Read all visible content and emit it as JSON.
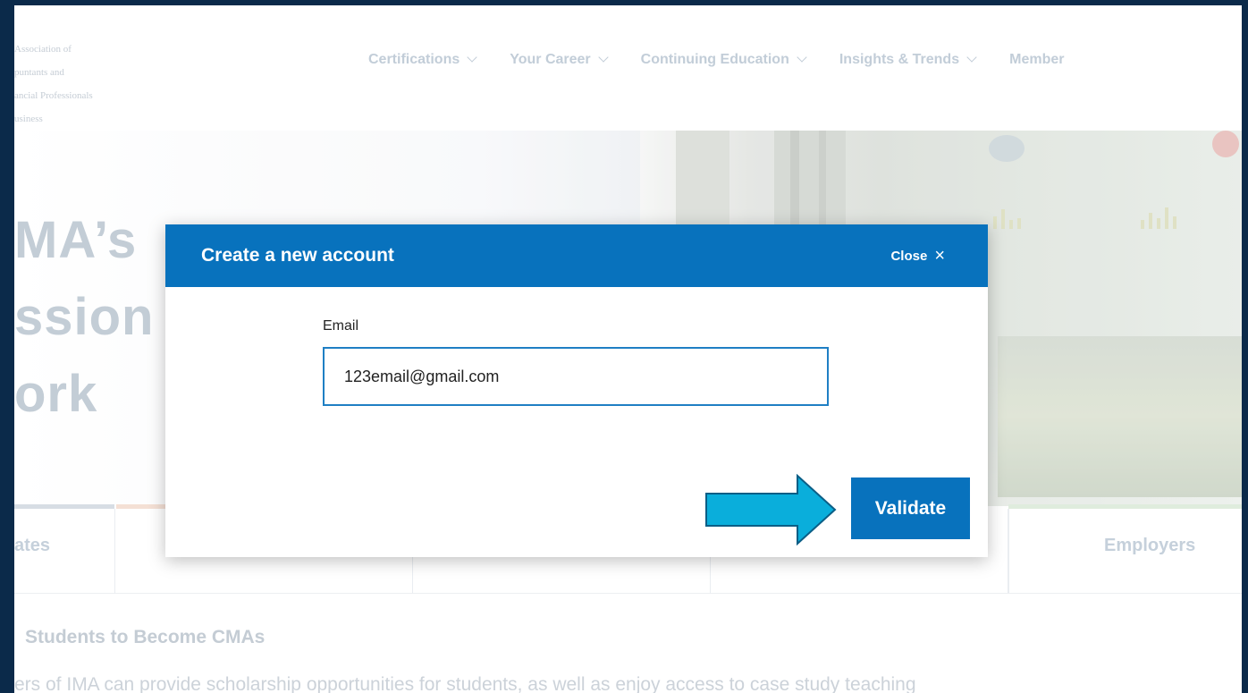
{
  "header": {
    "logo_lines": [
      "Association of",
      "puntants and",
      "ancial Professionals",
      "usiness"
    ],
    "nav": [
      {
        "label": "Certifications"
      },
      {
        "label": "Your Career"
      },
      {
        "label": "Continuing Education"
      },
      {
        "label": "Insights & Trends"
      },
      {
        "label": "Member"
      }
    ]
  },
  "hero": {
    "title_lines": [
      "MA’s",
      "ssion",
      "ork"
    ]
  },
  "tabs": [
    {
      "label": "ates"
    },
    {
      "label": ""
    },
    {
      "label": ""
    },
    {
      "label": "Employers"
    }
  ],
  "section": {
    "heading": " Students to Become CMAs",
    "body": "ers of IMA can provide scholarship opportunities for students, as well as enjoy access to case study teaching"
  },
  "modal": {
    "title": "Create a new account",
    "close_label": "Close",
    "close_icon": "×",
    "email_label": "Email",
    "email_value": "123email@gmail.com",
    "validate_label": "Validate"
  },
  "colors": {
    "brand_blue": "#0872bd",
    "arrow_fill": "#0aaedb",
    "page_border": "#0b2a4a"
  }
}
